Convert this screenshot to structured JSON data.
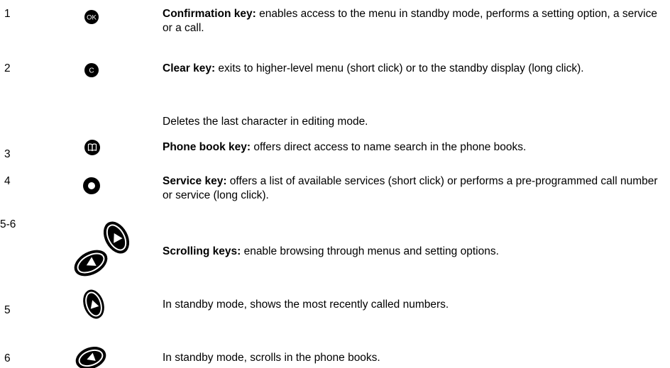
{
  "rows": [
    {
      "number": "1",
      "icon": "ok-key-icon",
      "icon_text": "OK",
      "title": "Confirmation key:",
      "text": " enables access to the menu in standby mode, performs a setting option, a service or a call."
    },
    {
      "number": "2",
      "icon": "clear-key-icon",
      "icon_text": "C",
      "title": "Clear key:",
      "text": " exits to higher-level menu (short click) or to the standby display (long click).",
      "extra": "Deletes the last character in editing mode."
    },
    {
      "number": "3",
      "icon": "phone-book-key-icon",
      "title": "Phone book key:",
      "text": " offers direct access to name search in the phone books."
    },
    {
      "number": "4",
      "icon": "service-key-icon",
      "title": "Service key:",
      "text": " offers a list of available services (short click) or performs a pre-programmed call number or service (long click)."
    },
    {
      "number": "5-6",
      "icon": "scrolling-keys-icon",
      "title": "Scrolling keys:",
      "text": " enable browsing through menus and setting options."
    },
    {
      "number": "5",
      "icon": "scroll-up-key-icon",
      "text": "In standby mode, shows the most recently called numbers."
    },
    {
      "number": "6",
      "icon": "scroll-left-key-icon",
      "text": "In standby mode, scrolls in the phone books."
    }
  ],
  "colors": {
    "text": "#000000",
    "key_fill": "#000000",
    "key_symbol": "#ffffff"
  }
}
